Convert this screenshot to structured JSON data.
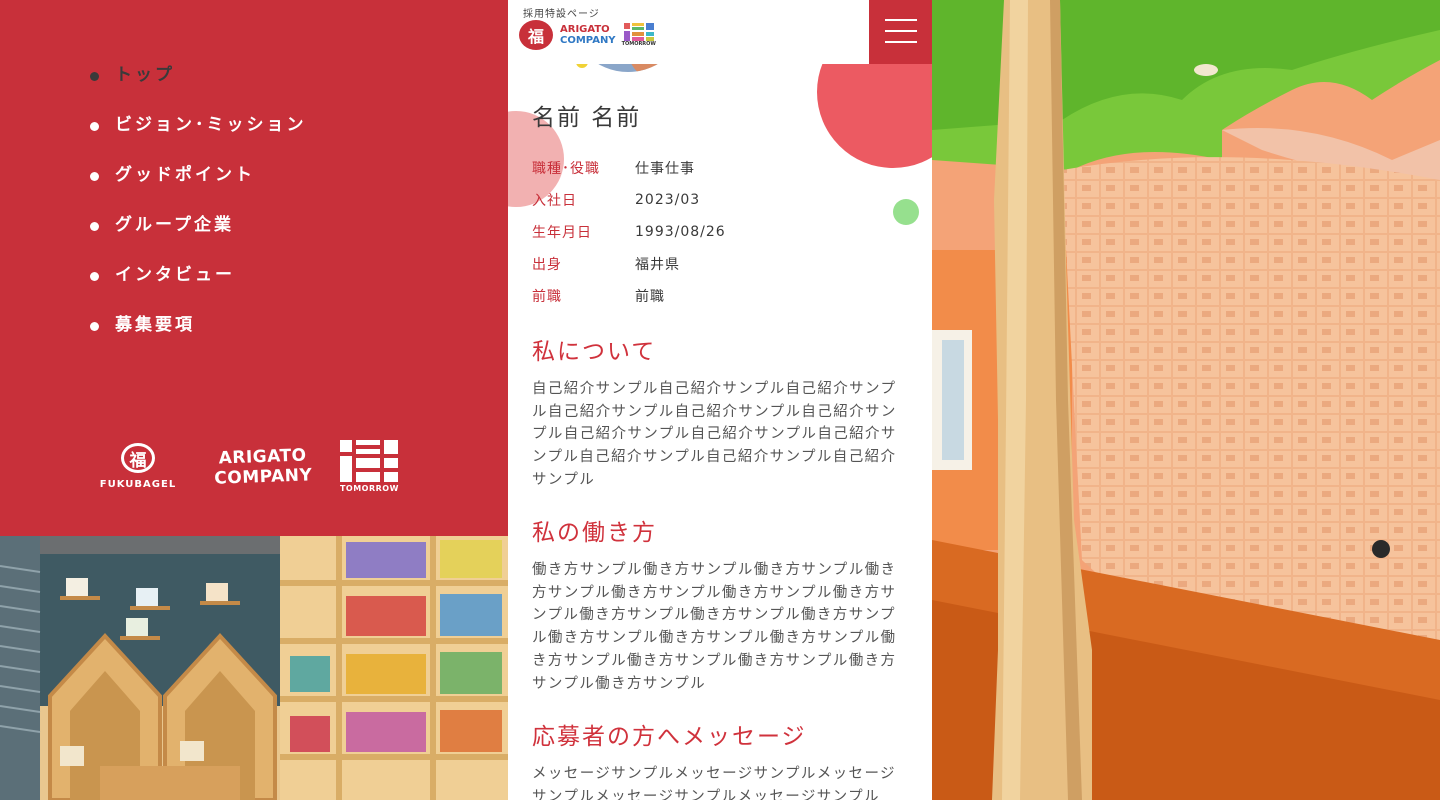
{
  "nav": {
    "items": [
      {
        "label": "トップ",
        "active": true
      },
      {
        "label": "ビジョン･ミッション",
        "active": false
      },
      {
        "label": "グッドポイント",
        "active": false
      },
      {
        "label": "グループ企業",
        "active": false
      },
      {
        "label": "インタビュー",
        "active": false
      },
      {
        "label": "募集要項",
        "active": false
      }
    ]
  },
  "group_logos": {
    "fuku_mark": "福",
    "fuku_text": "FUKUBAGEL",
    "arigato_line1": "ARIGATO",
    "arigato_line2": "COMPANY",
    "tomorrow_text": "TOMORROW"
  },
  "header": {
    "caption": "採用特設ページ",
    "fuku_mark": "福",
    "arigato_line1": "ARIGATO",
    "arigato_line2": "COMPANY",
    "tomorrow_text": "TOMORROW",
    "menu_icon": "hamburger-icon"
  },
  "profile": {
    "name": "名前 名前",
    "info": [
      {
        "key": "職種･役職",
        "value": "仕事仕事"
      },
      {
        "key": "入社日",
        "value": "2023/03"
      },
      {
        "key": "生年月日",
        "value": "1993/08/26"
      },
      {
        "key": "出身",
        "value": "福井県"
      },
      {
        "key": "前職",
        "value": "前職"
      }
    ]
  },
  "sections": [
    {
      "title": "私について",
      "body": "自己紹介サンプル自己紹介サンプル自己紹介サンプル自己紹介サンプル自己紹介サンプル自己紹介サンプル自己紹介サンプル自己紹介サンプル自己紹介サンプル自己紹介サンプル自己紹介サンプル自己紹介サンプル"
    },
    {
      "title": "私の働き方",
      "body": "働き方サンプル働き方サンプル働き方サンプル働き方サンプル働き方サンプル働き方サンプル働き方サンプル働き方サンプル働き方サンプル働き方サンプル働き方サンプル働き方サンプル働き方サンプル働き方サンプル働き方サンプル働き方サンプル働き方サンプル働き方サンプル"
    },
    {
      "title": "応募者の方へメッセージ",
      "body": "メッセージサンプルメッセージサンプルメッセージサンプルメッセージサンプルメッセージサンプル"
    }
  ],
  "colors": {
    "brand_red": "#c8303a",
    "accent_red": "#ec5a62",
    "accent_pink": "#f0a3a3",
    "accent_green": "#96e08e",
    "accent_yellow": "#f0d235"
  }
}
